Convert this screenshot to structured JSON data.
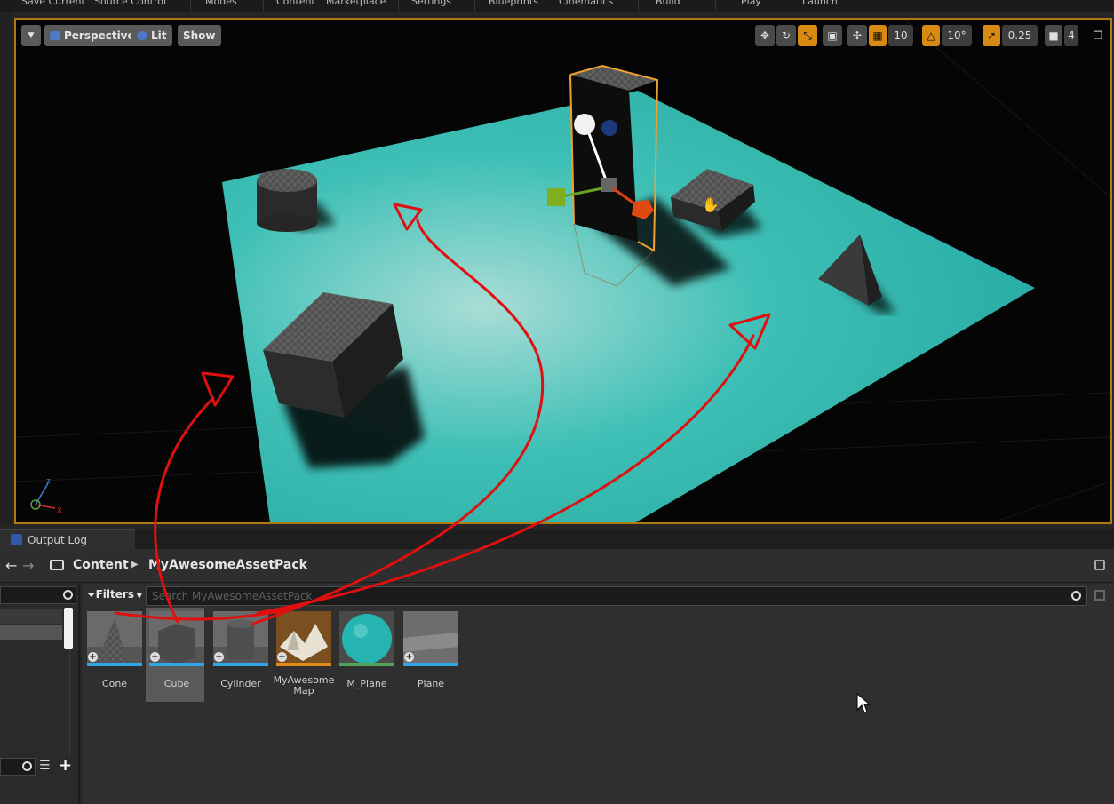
{
  "toolbar": {
    "items": [
      "Save Current",
      "Source Control",
      "Modes",
      "Content",
      "Marketplace",
      "Settings",
      "Blueprints",
      "Cinematics",
      "Build",
      "Play",
      "Launch"
    ]
  },
  "viewport": {
    "perspective_label": "Perspective",
    "lit_label": "Lit",
    "show_label": "Show",
    "grid_snap_value": "10",
    "rotation_snap_value": "10°",
    "scale_snap_value": "0.25",
    "camera_speed_value": "4",
    "axis_x": "x",
    "axis_z": "z"
  },
  "output_log": {
    "label": "Output Log"
  },
  "breadcrumb": {
    "root": "Content",
    "folder": "MyAwesomeAssetPack"
  },
  "content_browser": {
    "filters_label": "Filters",
    "search_placeholder": "Search MyAwesomeAssetPack",
    "assets": [
      {
        "name": "Cone",
        "type_color": "#2ea6e8"
      },
      {
        "name": "Cube",
        "type_color": "#2ea6e8",
        "selected": true
      },
      {
        "name": "Cylinder",
        "type_color": "#2ea6e8"
      },
      {
        "name": "MyAwesome Map",
        "type_color": "#e08a18"
      },
      {
        "name": "M_Plane",
        "type_color": "#52a35a"
      },
      {
        "name": "Plane",
        "type_color": "#2ea6e8"
      }
    ]
  },
  "colors": {
    "selection_outline": "#f0a030",
    "floor": "#2fb8b0",
    "annotation": "#e01010"
  }
}
